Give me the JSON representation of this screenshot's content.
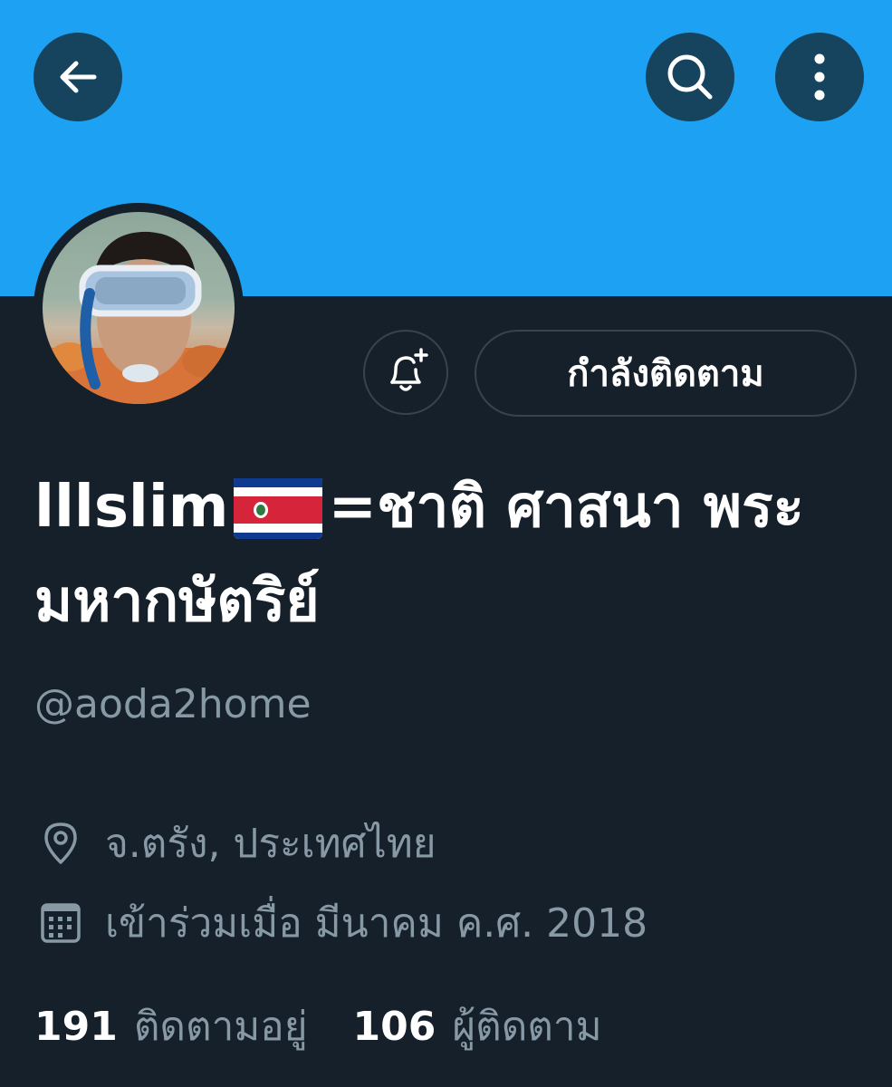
{
  "header": {
    "back_icon": "arrow-left-icon",
    "search_icon": "search-icon",
    "more_icon": "more-vertical-icon"
  },
  "profile": {
    "display_name_part1": "lllslim",
    "flag_icon": "costa-rica-flag-icon",
    "display_name_part2": "=ชาติ ศาสนา พระมหากษัตริย์",
    "handle": "@aoda2home",
    "location": "จ.ตรัง, ประเทศไทย",
    "joined": "เข้าร่วมเมื่อ มีนาคม ค.ศ. 2018"
  },
  "actions": {
    "notify_icon": "bell-plus-icon",
    "follow_label": "กำลังติดตาม"
  },
  "stats": {
    "following_count": "191",
    "following_label": "ติดตามอยู่",
    "followers_count": "106",
    "followers_label": "ผู้ติดตาม"
  },
  "colors": {
    "banner": "#1da1f2",
    "background": "#15202b",
    "secondary_text": "#8899a6",
    "button_border": "#38444d"
  }
}
